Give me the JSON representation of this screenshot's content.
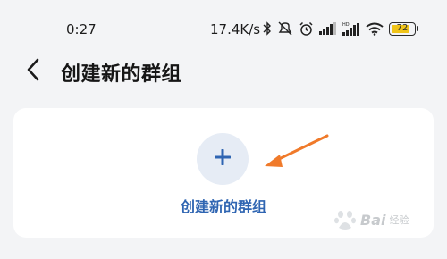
{
  "status_bar": {
    "time": "0:27",
    "network_speed": "17.4K/s",
    "battery_level": "72",
    "icons": [
      "bluetooth-icon",
      "mute-icon",
      "alarm-icon",
      "signal-icon",
      "signal-hd-icon",
      "wifi-icon",
      "battery-icon"
    ]
  },
  "header": {
    "back_icon": "chevron-left-icon",
    "title": "创建新的群组"
  },
  "card": {
    "button_icon": "plus-icon",
    "label": "创建新的群组"
  },
  "annotation": {
    "arrow_color": "#f07a2a"
  },
  "watermark": {
    "brand": "Bai",
    "sub": "经验"
  },
  "colors": {
    "background": "#f3f4f6",
    "card": "#ffffff",
    "accent": "#2f65b2",
    "button_bg": "#e6ecf5"
  }
}
